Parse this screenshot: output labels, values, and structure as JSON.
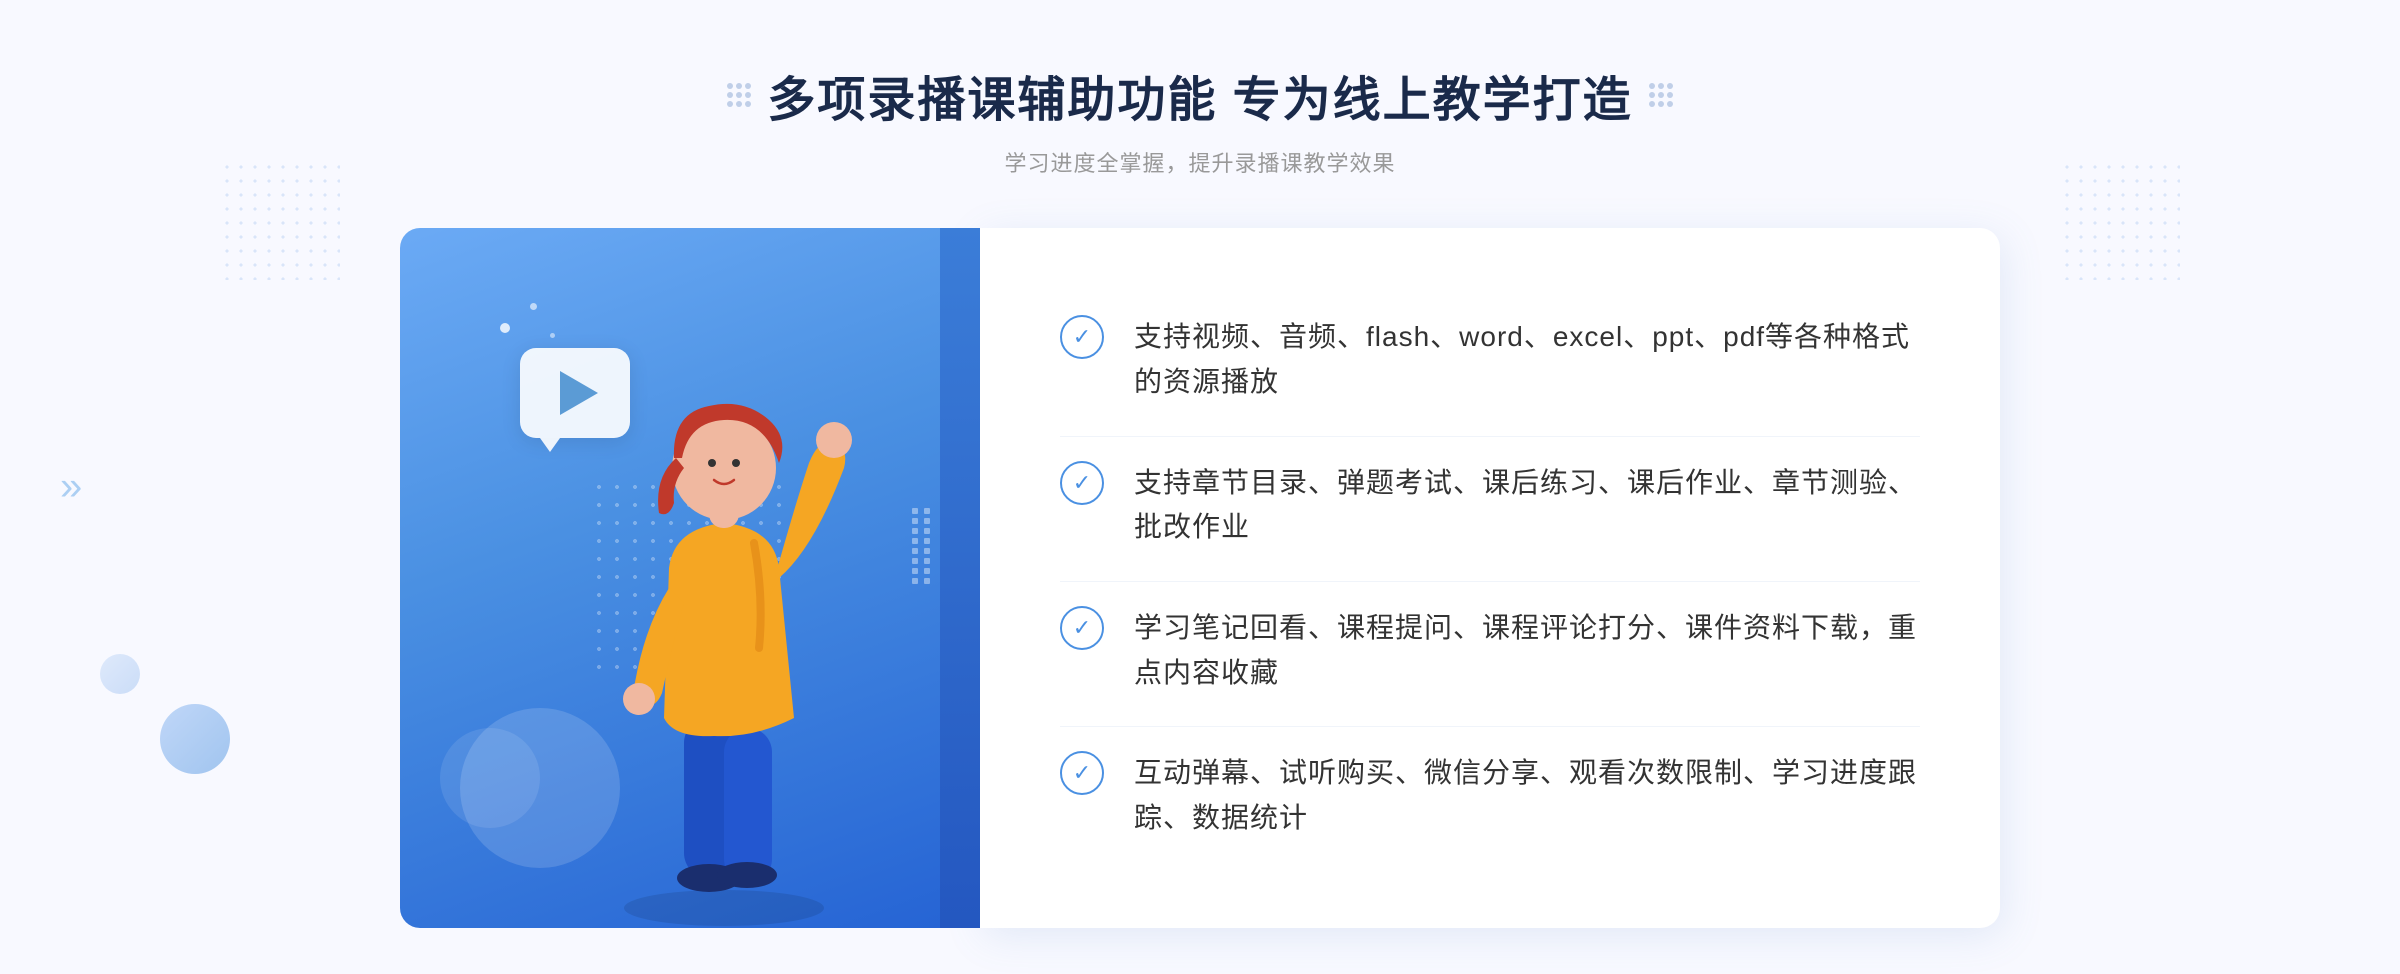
{
  "header": {
    "title": "多项录播课辅助功能 专为线上教学打造",
    "subtitle": "学习进度全掌握，提升录播课教学效果"
  },
  "features": [
    {
      "id": 1,
      "text": "支持视频、音频、flash、word、excel、ppt、pdf等各种格式的资源播放"
    },
    {
      "id": 2,
      "text": "支持章节目录、弹题考试、课后练习、课后作业、章节测验、批改作业"
    },
    {
      "id": 3,
      "text": "学习笔记回看、课程提问、课程评论打分、课件资料下载，重点内容收藏"
    },
    {
      "id": 4,
      "text": "互动弹幕、试听购买、微信分享、观看次数限制、学习进度跟踪、数据统计"
    }
  ],
  "colors": {
    "primary": "#4a90e2",
    "dark": "#2563d4",
    "text_dark": "#1a2a4a",
    "text_light": "#999",
    "text_body": "#333"
  },
  "icons": {
    "check": "✓",
    "play": "▶",
    "chevron_right": "»"
  }
}
